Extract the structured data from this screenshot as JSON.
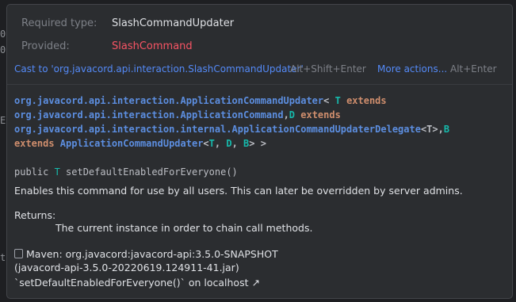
{
  "type_info": {
    "required_label": "Required type:",
    "required_value": "SlashCommandUpdater",
    "provided_label": "Provided:",
    "provided_value": "SlashCommand"
  },
  "actions": {
    "cast_label": "Cast to 'org.javacord.api.interaction.SlashCommandUpdater'",
    "cast_shortcut": "Alt+Shift+Enter",
    "more_label": "More actions...",
    "more_shortcut": "Alt+Enter"
  },
  "declaration": {
    "line1_pkg": "org.javacord.api.interaction.ApplicationCommandUpdater",
    "line1_lt": "<",
    "line1_T": " T ",
    "line1_extends": "extends",
    "line2_pkg": "org.javacord.api.interaction.ApplicationCommand",
    "line2_comma": ",",
    "line2_D": "D",
    "line2_extends": " extends",
    "line3_pkg": "org.javacord.api.interaction.internal.ApplicationCommandUpdaterDelegate",
    "line3_T": "<T>",
    "line3_comma": ",",
    "line3_B": "B",
    "line4_extends": "extends",
    "line4_cls": " ApplicationCommandUpdater",
    "line4_lt": "<",
    "line4_T": "T",
    "line4_c1": ", ",
    "line4_D": "D",
    "line4_c2": ", ",
    "line4_B": "B",
    "line4_end": "> >"
  },
  "method": {
    "modifier": "public ",
    "type": "T",
    "name": " setDefaultEnabledForEveryone()"
  },
  "doc": {
    "description": "Enables this command for use by all users. This can later be overridden by server admins.",
    "returns_label": "Returns:",
    "returns_text": "The current instance in order to chain call methods."
  },
  "source": {
    "maven_line": "Maven: org.javacord:javacord-api:3.5.0-SNAPSHOT",
    "jar_line": "(javacord-api-3.5.0-20220619.124911-41.jar)",
    "link": "`setDefaultEnabledForEveryone()` on localhost ↗"
  }
}
